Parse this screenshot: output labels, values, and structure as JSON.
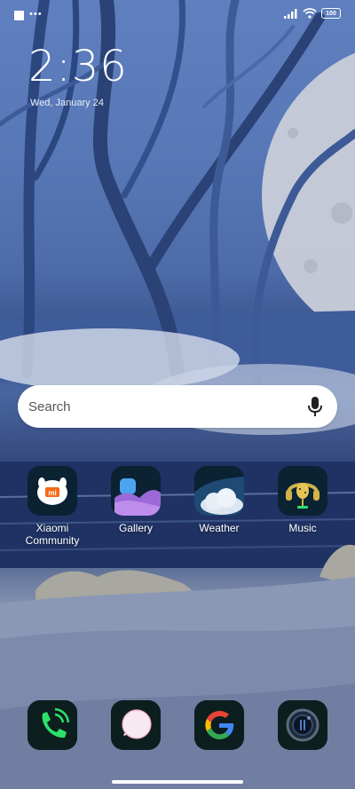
{
  "status_bar": {
    "notification_dots": "•••",
    "battery": "100"
  },
  "clock": {
    "time": "2:36",
    "date": "Wed, January 24"
  },
  "search": {
    "placeholder": "Search"
  },
  "apps": [
    {
      "label": "Xiaomi Community",
      "icon": "xiaomi-community-icon"
    },
    {
      "label": "Gallery",
      "icon": "gallery-icon"
    },
    {
      "label": "Weather",
      "icon": "weather-icon"
    },
    {
      "label": "Music",
      "icon": "music-icon"
    }
  ],
  "dock": [
    {
      "icon": "phone-icon"
    },
    {
      "icon": "messaging-icon"
    },
    {
      "icon": "google-icon"
    },
    {
      "icon": "camera-icon"
    }
  ],
  "colors": {
    "search_bg": "#ffffff",
    "app_icon_bg": "#0b2233",
    "phone_green": "#2ee06b",
    "gallery_purple": "#9b6ad8",
    "music_gold": "#d2b34a"
  }
}
